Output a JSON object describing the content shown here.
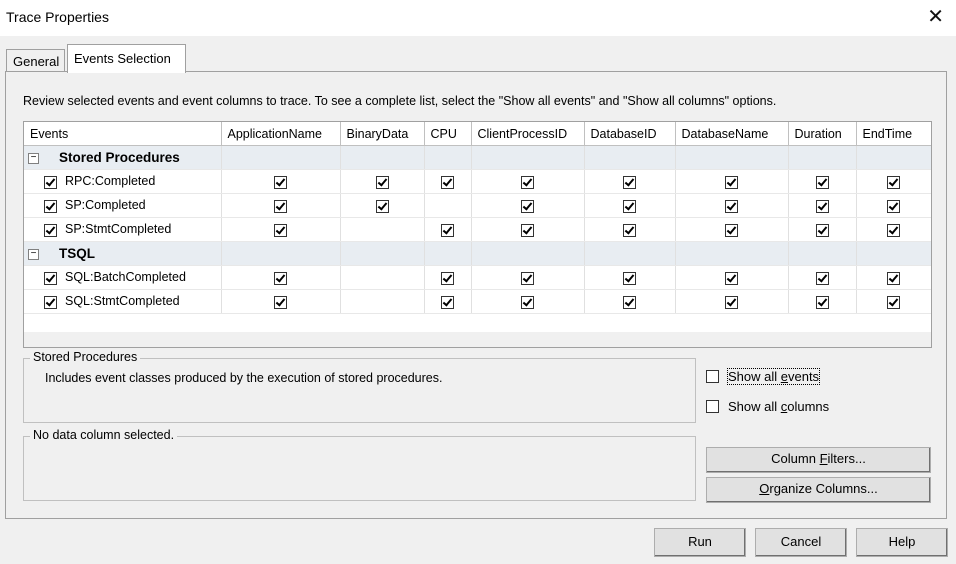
{
  "window": {
    "title": "Trace Properties",
    "close_glyph": "✕"
  },
  "tabs": [
    {
      "label": "General"
    },
    {
      "label": "Events Selection"
    }
  ],
  "instructions": "Review selected events and event columns to trace. To see a complete list, select the \"Show all events\" and \"Show all columns\" options.",
  "grid": {
    "columns": [
      "Events",
      "ApplicationName",
      "BinaryData",
      "CPU",
      "ClientProcessID",
      "DatabaseID",
      "DatabaseName",
      "Duration",
      "EndTime"
    ],
    "categories": [
      {
        "name": "Stored Procedures",
        "expander": "−",
        "events": [
          {
            "name": "RPC:Completed",
            "selected": true,
            "cols": [
              true,
              true,
              true,
              true,
              true,
              true,
              true,
              true
            ]
          },
          {
            "name": "SP:Completed",
            "selected": true,
            "cols": [
              true,
              true,
              false,
              true,
              true,
              true,
              true,
              true
            ]
          },
          {
            "name": "SP:StmtCompleted",
            "selected": true,
            "cols": [
              true,
              false,
              true,
              true,
              true,
              true,
              true,
              true
            ]
          }
        ]
      },
      {
        "name": "TSQL",
        "expander": "−",
        "events": [
          {
            "name": "SQL:BatchCompleted",
            "selected": true,
            "cols": [
              true,
              false,
              true,
              true,
              true,
              true,
              true,
              true
            ]
          },
          {
            "name": "SQL:StmtCompleted",
            "selected": true,
            "cols": [
              true,
              false,
              true,
              true,
              true,
              true,
              true,
              true
            ]
          }
        ]
      }
    ]
  },
  "description_box": {
    "legend": "Stored Procedures",
    "text": "Includes event classes produced by the execution of stored procedures."
  },
  "column_box": {
    "legend": "No data column selected."
  },
  "options": {
    "show_all_events": {
      "label": "Show all events",
      "checked": false
    },
    "show_all_columns": {
      "label": "Show all columns",
      "checked": false
    }
  },
  "buttons": {
    "column_filters": "Column Filters...",
    "organize_columns": "Organize Columns...",
    "run": "Run",
    "cancel": "Cancel",
    "help": "Help"
  },
  "icons": {
    "close": "close-icon",
    "checkbox": "checkbox-icon",
    "expander": "collapse-icon"
  }
}
